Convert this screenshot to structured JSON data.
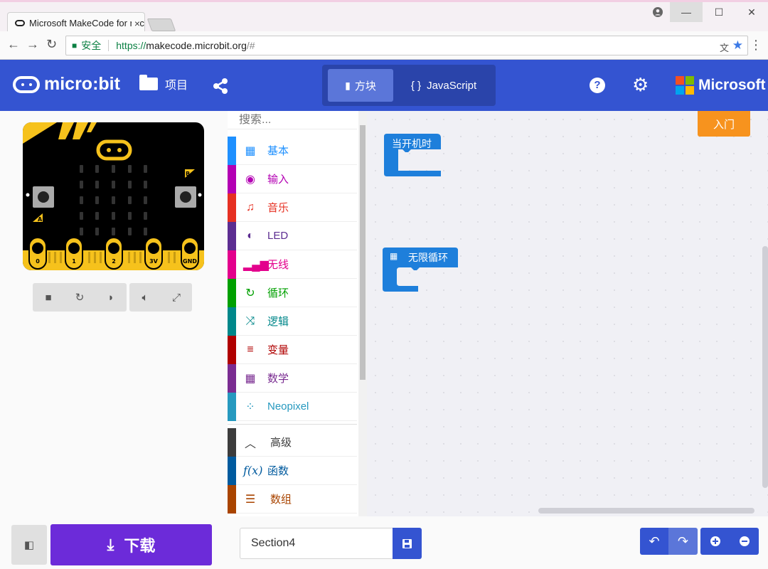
{
  "browser": {
    "tab_title": "Microsoft MakeCode for micro:bit",
    "tab_close": "×",
    "secure_label": "安全",
    "url_scheme": "https://",
    "url_host": "makecode.microbit.org",
    "url_rest": "/#",
    "win_min": "—",
    "win_max": "☐",
    "win_close": "✕"
  },
  "header": {
    "logo_text": "micro:bit",
    "projects_label": "项目",
    "tabs": {
      "blocks": "方块",
      "javascript": "JavaScript",
      "js_braces": "{ }"
    },
    "microsoft_label": "Microsoft",
    "help_glyph": "?"
  },
  "simulator": {
    "pins": [
      "0",
      "1",
      "2",
      "3V",
      "GND"
    ],
    "button_a": "A",
    "button_b": "B"
  },
  "toolbox": {
    "search_placeholder": "搜索...",
    "categories": [
      {
        "label": "基本",
        "color": "#1e90ff",
        "icon": "grid-icon"
      },
      {
        "label": "输入",
        "color": "#d400d4",
        "icon": "target-icon"
      },
      {
        "label": "音乐",
        "color": "#e63022",
        "icon": "headphones-icon"
      },
      {
        "label": "LED",
        "color": "#5c2d91",
        "icon": "toggle-icon"
      },
      {
        "label": "无线",
        "color": "#e3008c",
        "icon": "signal-bars-icon"
      },
      {
        "label": "循环",
        "color": "#00aa00",
        "icon": "refresh-icon"
      },
      {
        "label": "逻辑",
        "color": "#00a4a6",
        "icon": "shuffle-icon"
      },
      {
        "label": "变量",
        "color": "#dc143c",
        "icon": "list-lines-icon"
      },
      {
        "label": "数学",
        "color": "#9400d3",
        "icon": "calculator-icon"
      },
      {
        "label": "Neopixel",
        "color": "#2699bf",
        "icon": "dotted-ring-icon"
      }
    ],
    "advanced": [
      {
        "label": "高级",
        "color": "#3c3c3c",
        "icon": "chevron-up-icon"
      },
      {
        "label": "函数",
        "color": "#005a9e",
        "icon": "function-icon"
      },
      {
        "label": "数组",
        "color": "#a94400",
        "icon": "numbered-list-icon"
      }
    ]
  },
  "workspace": {
    "getting_started": "入门",
    "blocks": [
      {
        "label": "当开机时",
        "color": "#1e90ff"
      },
      {
        "label": "无限循环",
        "color": "#1e90ff"
      }
    ]
  },
  "footer": {
    "download_label": "下载",
    "project_name": "Section4"
  },
  "colors": {
    "header_bg": "#3454d1",
    "download_bg": "#6c2bd9",
    "getting_started_bg": "#f7931e"
  }
}
